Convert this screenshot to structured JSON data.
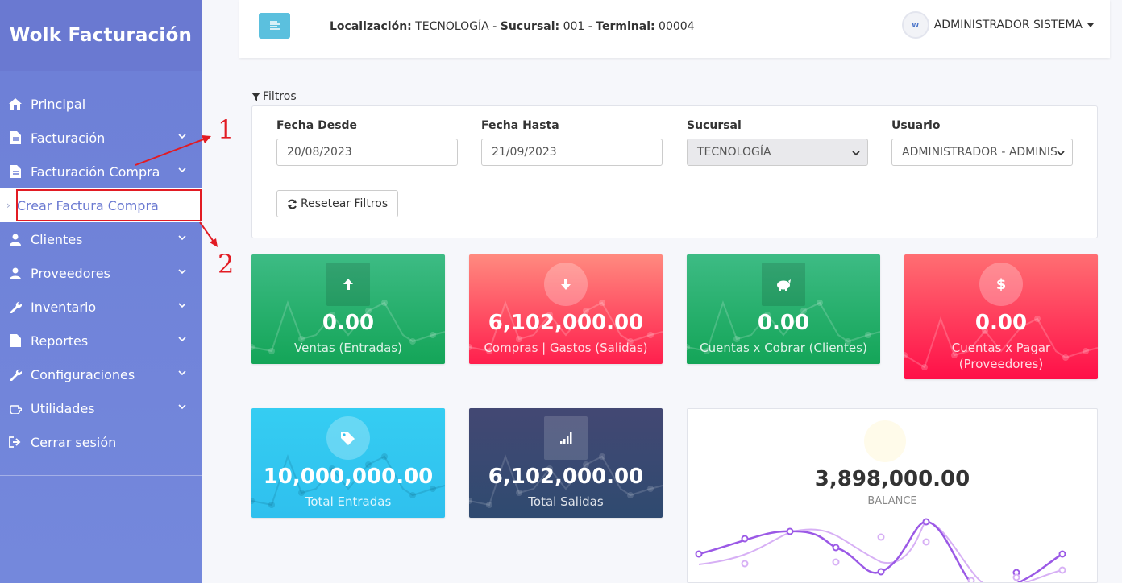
{
  "app": {
    "brand": "Wolk Facturación"
  },
  "sidebar": {
    "items": [
      {
        "label": "Principal",
        "icon": "home-icon",
        "chevron": false
      },
      {
        "label": "Facturación",
        "icon": "file-icon",
        "chevron": true
      },
      {
        "label": "Facturación Compra",
        "icon": "file-icon",
        "chevron": true
      },
      {
        "label": "Crear Factura Compra",
        "icon": "chevron-right-icon",
        "chevron": false,
        "sub": true
      },
      {
        "label": "Clientes",
        "icon": "user-icon",
        "chevron": true
      },
      {
        "label": "Proveedores",
        "icon": "user-icon",
        "chevron": true
      },
      {
        "label": "Inventario",
        "icon": "wrench-icon",
        "chevron": true
      },
      {
        "label": "Reportes",
        "icon": "file-icon",
        "chevron": true
      },
      {
        "label": "Configuraciones",
        "icon": "wrench-icon",
        "chevron": true
      },
      {
        "label": "Utilidades",
        "icon": "hand-icon",
        "chevron": true
      },
      {
        "label": "Cerrar sesión",
        "icon": "sign-out-icon",
        "chevron": false
      }
    ]
  },
  "header": {
    "loc_label": "Localización:",
    "loc_value": "TECNOLOGÍA",
    "suc_label": "Sucursal:",
    "suc_value": "001",
    "term_label": "Terminal:",
    "term_value": "00004",
    "separator": "-",
    "user_name": "ADMINISTRADOR SISTEMA",
    "avatar_text": "W"
  },
  "filters": {
    "title": "Filtros",
    "fecha_desde_label": "Fecha Desde",
    "fecha_desde_value": "20/08/2023",
    "fecha_hasta_label": "Fecha Hasta",
    "fecha_hasta_value": "21/09/2023",
    "sucursal_label": "Sucursal",
    "sucursal_value": "TECNOLOGÍA",
    "usuario_label": "Usuario",
    "usuario_value": "ADMINISTRADOR - ADMINIS",
    "reset_label": "Resetear Filtros"
  },
  "cards": [
    {
      "value": "0.00",
      "label": "Ventas (Entradas)",
      "icon": "arrow-up-icon"
    },
    {
      "value": "6,102,000.00",
      "label": "Compras | Gastos (Salidas)",
      "icon": "arrow-down-icon"
    },
    {
      "value": "0.00",
      "label": "Cuentas x Cobrar (Clientes)",
      "icon": "piggy-bank-icon"
    },
    {
      "value": "0.00",
      "label": "Cuentas x Pagar (Proveedores)",
      "icon": "dollar-icon"
    },
    {
      "value": "10,000,000.00",
      "label": "Total Entradas",
      "icon": "tags-icon"
    },
    {
      "value": "6,102,000.00",
      "label": "Total Salidas",
      "icon": "signal-icon"
    }
  ],
  "balance": {
    "value": "3,898,000.00",
    "label": "BALANCE"
  },
  "annotations": {
    "one": "1",
    "two": "2"
  },
  "colors": {
    "sidebar": "#6d7fd6",
    "accent": "#5bc0de",
    "green": "#14a558",
    "red": "#ff1f4d",
    "cyan": "#2fc0ee",
    "navy": "#2f4a70",
    "annotation": "#e21b23",
    "purple": "#9b59e6"
  }
}
